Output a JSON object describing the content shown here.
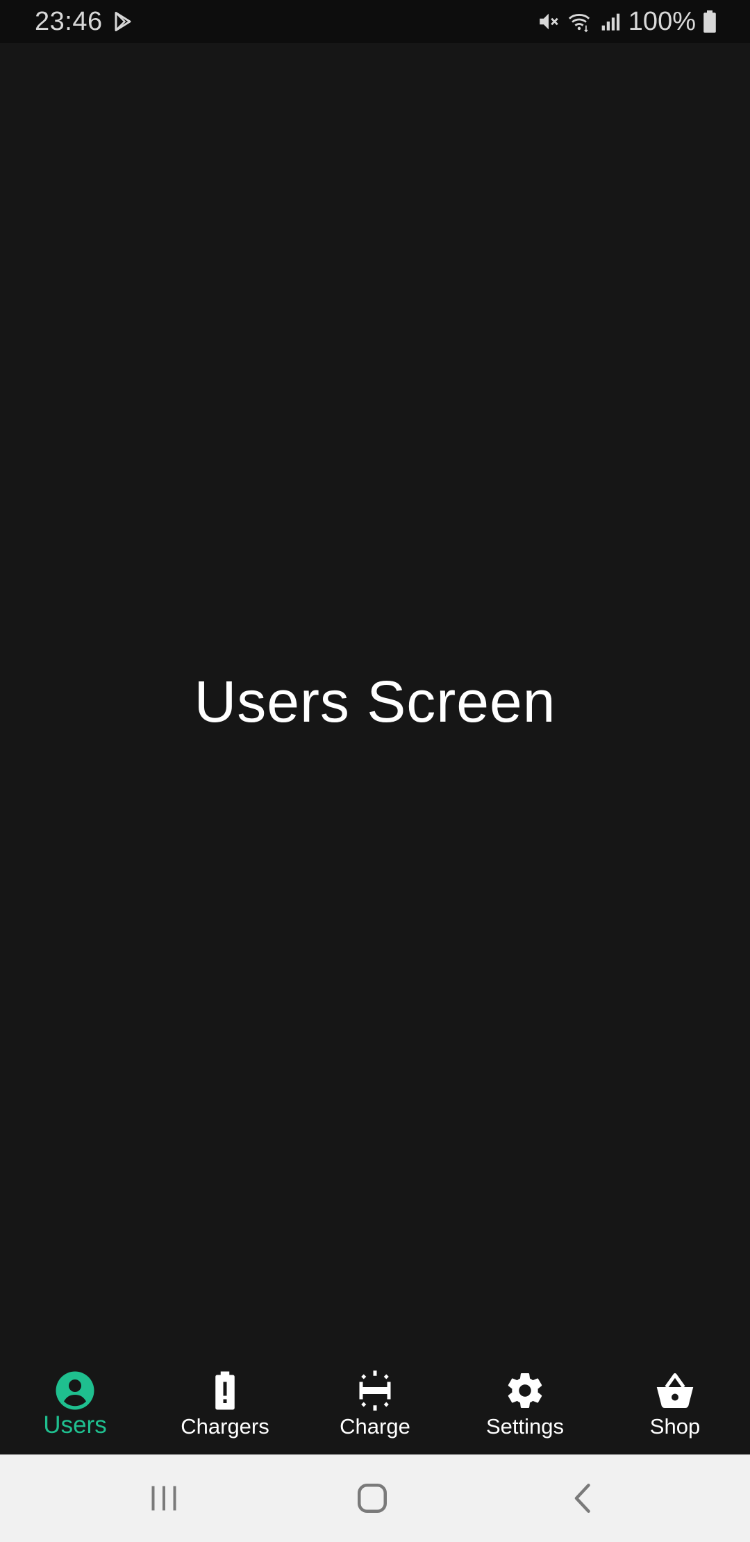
{
  "status_bar": {
    "time": "23:46",
    "battery_text": "100%",
    "icons": [
      "play-store-icon",
      "mute-icon",
      "wifi-icon",
      "signal-icon",
      "battery-icon"
    ]
  },
  "main": {
    "title": "Users Screen"
  },
  "bottom_nav": {
    "accent_color": "#1fbf8f",
    "items": [
      {
        "label": "Users",
        "icon": "account-circle-icon",
        "active": true
      },
      {
        "label": "Chargers",
        "icon": "battery-alert-icon",
        "active": false
      },
      {
        "label": "Charge",
        "icon": "charge-station-icon",
        "active": false
      },
      {
        "label": "Settings",
        "icon": "gear-icon",
        "active": false
      },
      {
        "label": "Shop",
        "icon": "basket-icon",
        "active": false
      }
    ]
  },
  "system_nav": {
    "buttons": [
      "recents-icon",
      "home-icon",
      "back-icon"
    ]
  }
}
